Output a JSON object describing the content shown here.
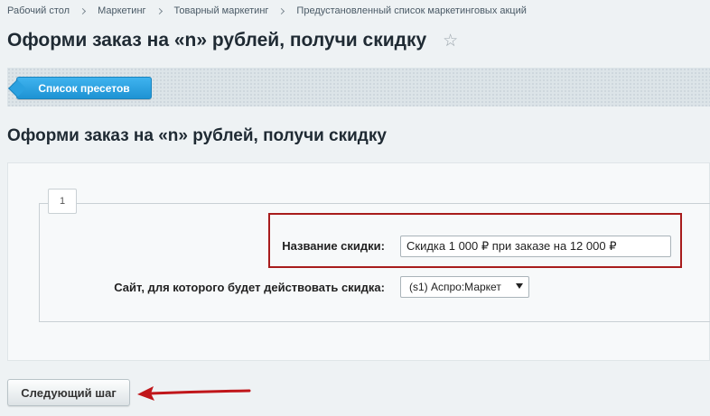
{
  "breadcrumb": {
    "items": [
      "Рабочий стол",
      "Маркетинг",
      "Товарный маркетинг",
      "Предустановленный список маркетинговых акций"
    ]
  },
  "page": {
    "title": "Оформи заказ на «n» рублей, получи скидку",
    "favorite_icon": "star-icon"
  },
  "toolbar": {
    "presets_button": "Список пресетов"
  },
  "section": {
    "title": "Оформи заказ на «n» рублей, получи скидку"
  },
  "form": {
    "step_tab": "1",
    "discount_name_label": "Название скидки:",
    "discount_name_value": "Скидка 1 000 ₽ при заказе на 12 000 ₽",
    "site_label": "Сайт, для которого будет действовать скидка:",
    "site_selected": "(s1) Аспро:Маркет"
  },
  "actions": {
    "next_button": "Следующий шаг"
  },
  "colors": {
    "accent": "#2aa1e0",
    "highlight": "#a81c1c",
    "annotation_arrow": "#c0161a"
  }
}
